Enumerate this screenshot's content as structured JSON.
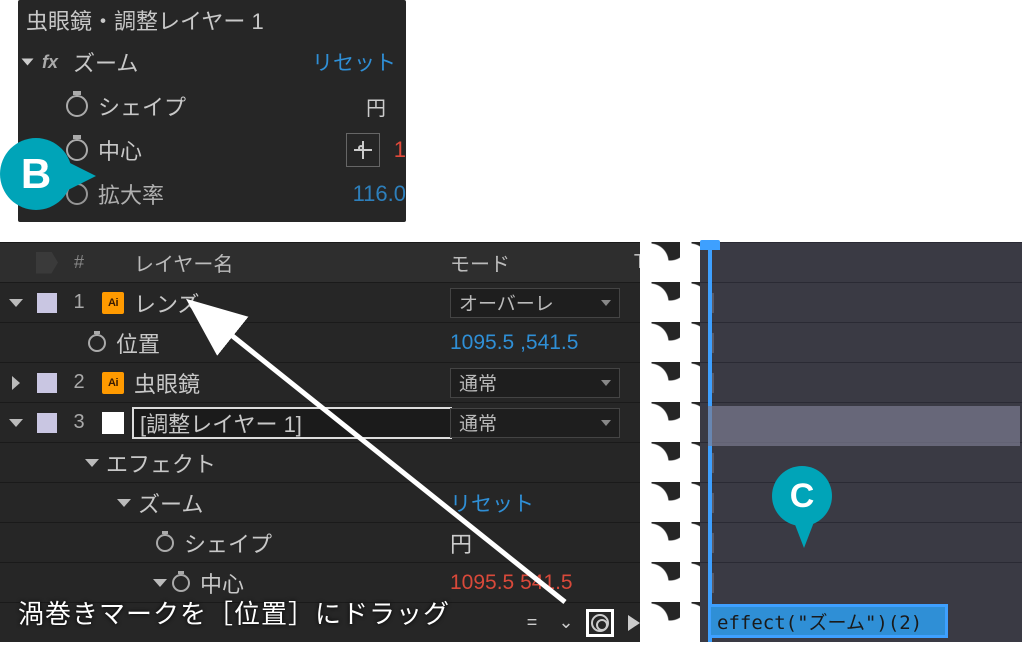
{
  "top_panel": {
    "title": "虫眼鏡・調整レイヤー 1",
    "effect": {
      "name": "ズーム",
      "reset": "リセット",
      "params": {
        "shape": {
          "label": "シェイプ",
          "value": "円"
        },
        "center": {
          "label": "中心",
          "value": "1"
        },
        "magnify": {
          "label": "拡大率",
          "value": "116.0"
        }
      }
    }
  },
  "timeline": {
    "headers": {
      "num": "#",
      "layer_name": "レイヤー名",
      "mode": "モード",
      "t": "T"
    },
    "layers": [
      {
        "num": "1",
        "name": "レンズ",
        "type": "ai",
        "mode": "オーバーレ",
        "props": {
          "position": {
            "label": "位置",
            "value": "1095.5 ,541.5"
          }
        }
      },
      {
        "num": "2",
        "name": "虫眼鏡",
        "type": "ai",
        "mode": "通常"
      },
      {
        "num": "3",
        "name": "[調整レイヤー 1]",
        "type": "solid",
        "mode": "通常",
        "effects_label": "エフェクト",
        "effect": {
          "name": "ズーム",
          "reset": "リセット",
          "params": {
            "shape": {
              "label": "シェイプ",
              "value": "円"
            },
            "center": {
              "label": "中心",
              "value": "1095.5 541.5"
            }
          }
        }
      }
    ]
  },
  "expression": {
    "text": "effect(\"ズーム\")(2)"
  },
  "callouts": {
    "b": "B",
    "c": "C"
  },
  "caption": "渦巻きマークを［位置］にドラッグ"
}
